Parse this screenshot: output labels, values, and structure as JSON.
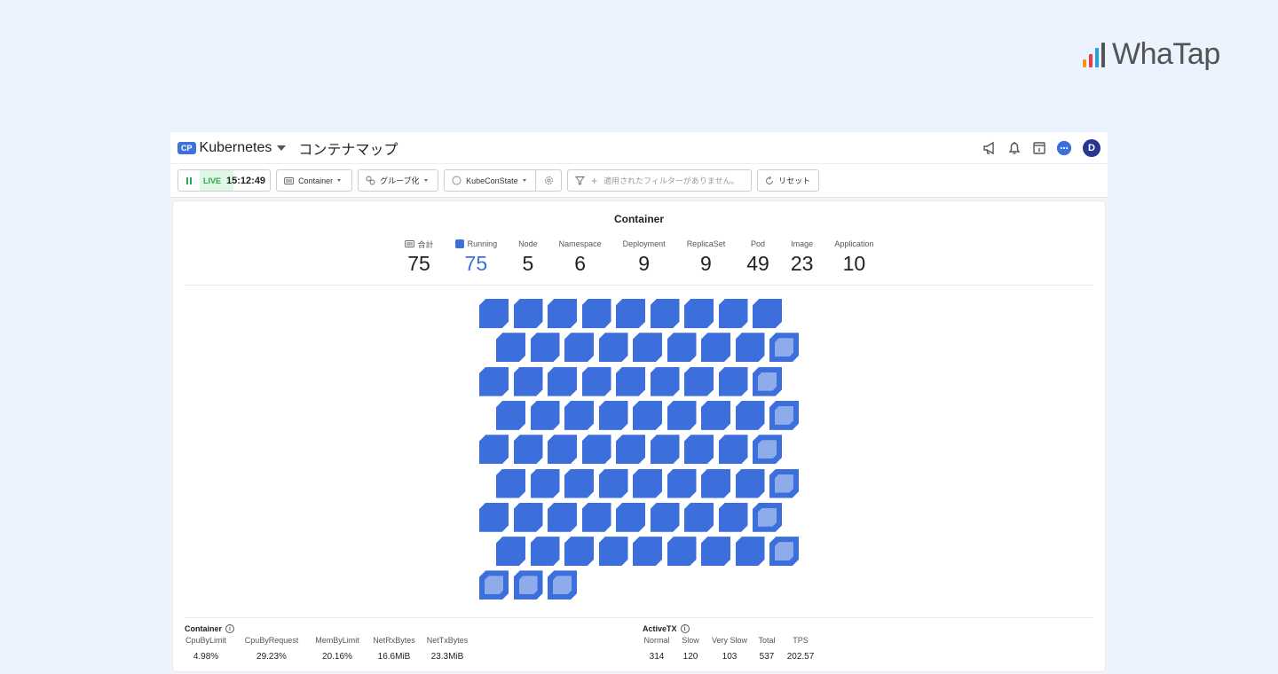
{
  "brand": {
    "name": "WhaTap",
    "bar_colors": [
      "#f7941d",
      "#ee3a43",
      "#2d9cdb",
      "#545454"
    ]
  },
  "header": {
    "product_badge": "CP",
    "product_name": "Kubernetes",
    "page_title": "コンテナマップ",
    "avatar_initial": "D",
    "icons": [
      "megaphone-icon",
      "bell-icon",
      "calendar-icon",
      "chat-icon"
    ]
  },
  "toolbar": {
    "live_label": "LIVE",
    "time": "15:12:49",
    "object_type": "Container",
    "group_label": "グループ化",
    "state_label": "KubeConState",
    "filter_placeholder": "適用されたフィルターがありません。",
    "reset_label": "リセット"
  },
  "panel": {
    "title": "Container",
    "summary": [
      {
        "label": "合計",
        "value": "75",
        "icon": "grid-icon"
      },
      {
        "label": "Running",
        "value": "75",
        "icon": "running-square-icon",
        "accent": true
      },
      {
        "label": "Node",
        "value": "5"
      },
      {
        "label": "Namespace",
        "value": "6"
      },
      {
        "label": "Deployment",
        "value": "9"
      },
      {
        "label": "ReplicaSet",
        "value": "9"
      },
      {
        "label": "Pod",
        "value": "49"
      },
      {
        "label": "Image",
        "value": "23"
      },
      {
        "label": "Application",
        "value": "10"
      }
    ],
    "container_map": {
      "total": 75,
      "columns": 9,
      "dim_indices": [
        17,
        26,
        35,
        44,
        53,
        62,
        71,
        72,
        73,
        74
      ],
      "color_running": "#3d6fdc",
      "color_dim": "#8eacec"
    }
  },
  "container_metrics": {
    "title": "Container",
    "columns": [
      {
        "label": "CpuByLimit",
        "value": "4.98%"
      },
      {
        "label": "CpuByRequest",
        "value": "29.23%"
      },
      {
        "label": "MemByLimit",
        "value": "20.16%"
      },
      {
        "label": "NetRxBytes",
        "value": "16.6MiB"
      },
      {
        "label": "NetTxBytes",
        "value": "23.3MiB"
      }
    ]
  },
  "activetx_metrics": {
    "title": "ActiveTX",
    "columns": [
      {
        "label": "Normal",
        "value": "314"
      },
      {
        "label": "Slow",
        "value": "120"
      },
      {
        "label": "Very Slow",
        "value": "103"
      },
      {
        "label": "Total",
        "value": "537"
      },
      {
        "label": "TPS",
        "value": "202.57"
      }
    ]
  }
}
